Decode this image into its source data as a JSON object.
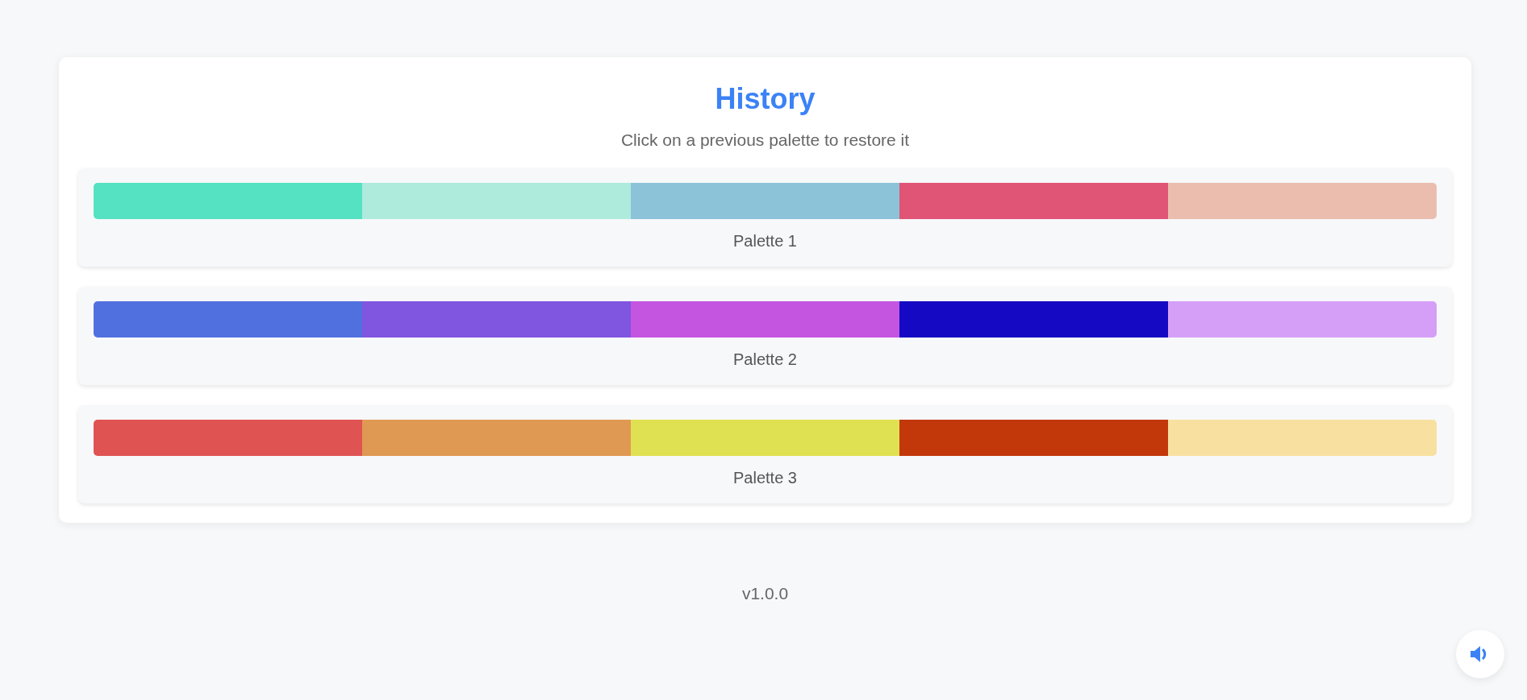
{
  "history": {
    "title": "History",
    "subtitle": "Click on a previous palette to restore it",
    "palettes": [
      {
        "label": "Palette 1",
        "swatches": [
          {
            "color": "#55e2c2"
          },
          {
            "color": "#aeebdd"
          },
          {
            "color": "#8dc3d9"
          },
          {
            "color": "#e05475"
          },
          {
            "color": "#ebbdae"
          }
        ]
      },
      {
        "label": "Palette 2",
        "swatches": [
          {
            "color": "#5170e0"
          },
          {
            "color": "#8055e0"
          },
          {
            "color": "#c455e0"
          },
          {
            "color": "#1509c4"
          },
          {
            "color": "#d59ff8"
          }
        ]
      },
      {
        "label": "Palette 3",
        "swatches": [
          {
            "color": "#e05353"
          },
          {
            "color": "#e09953"
          },
          {
            "color": "#e0e053"
          },
          {
            "color": "#c2380a"
          },
          {
            "color": "#f8e0a0"
          }
        ]
      }
    ]
  },
  "footer": {
    "version": "v1.0.0"
  }
}
